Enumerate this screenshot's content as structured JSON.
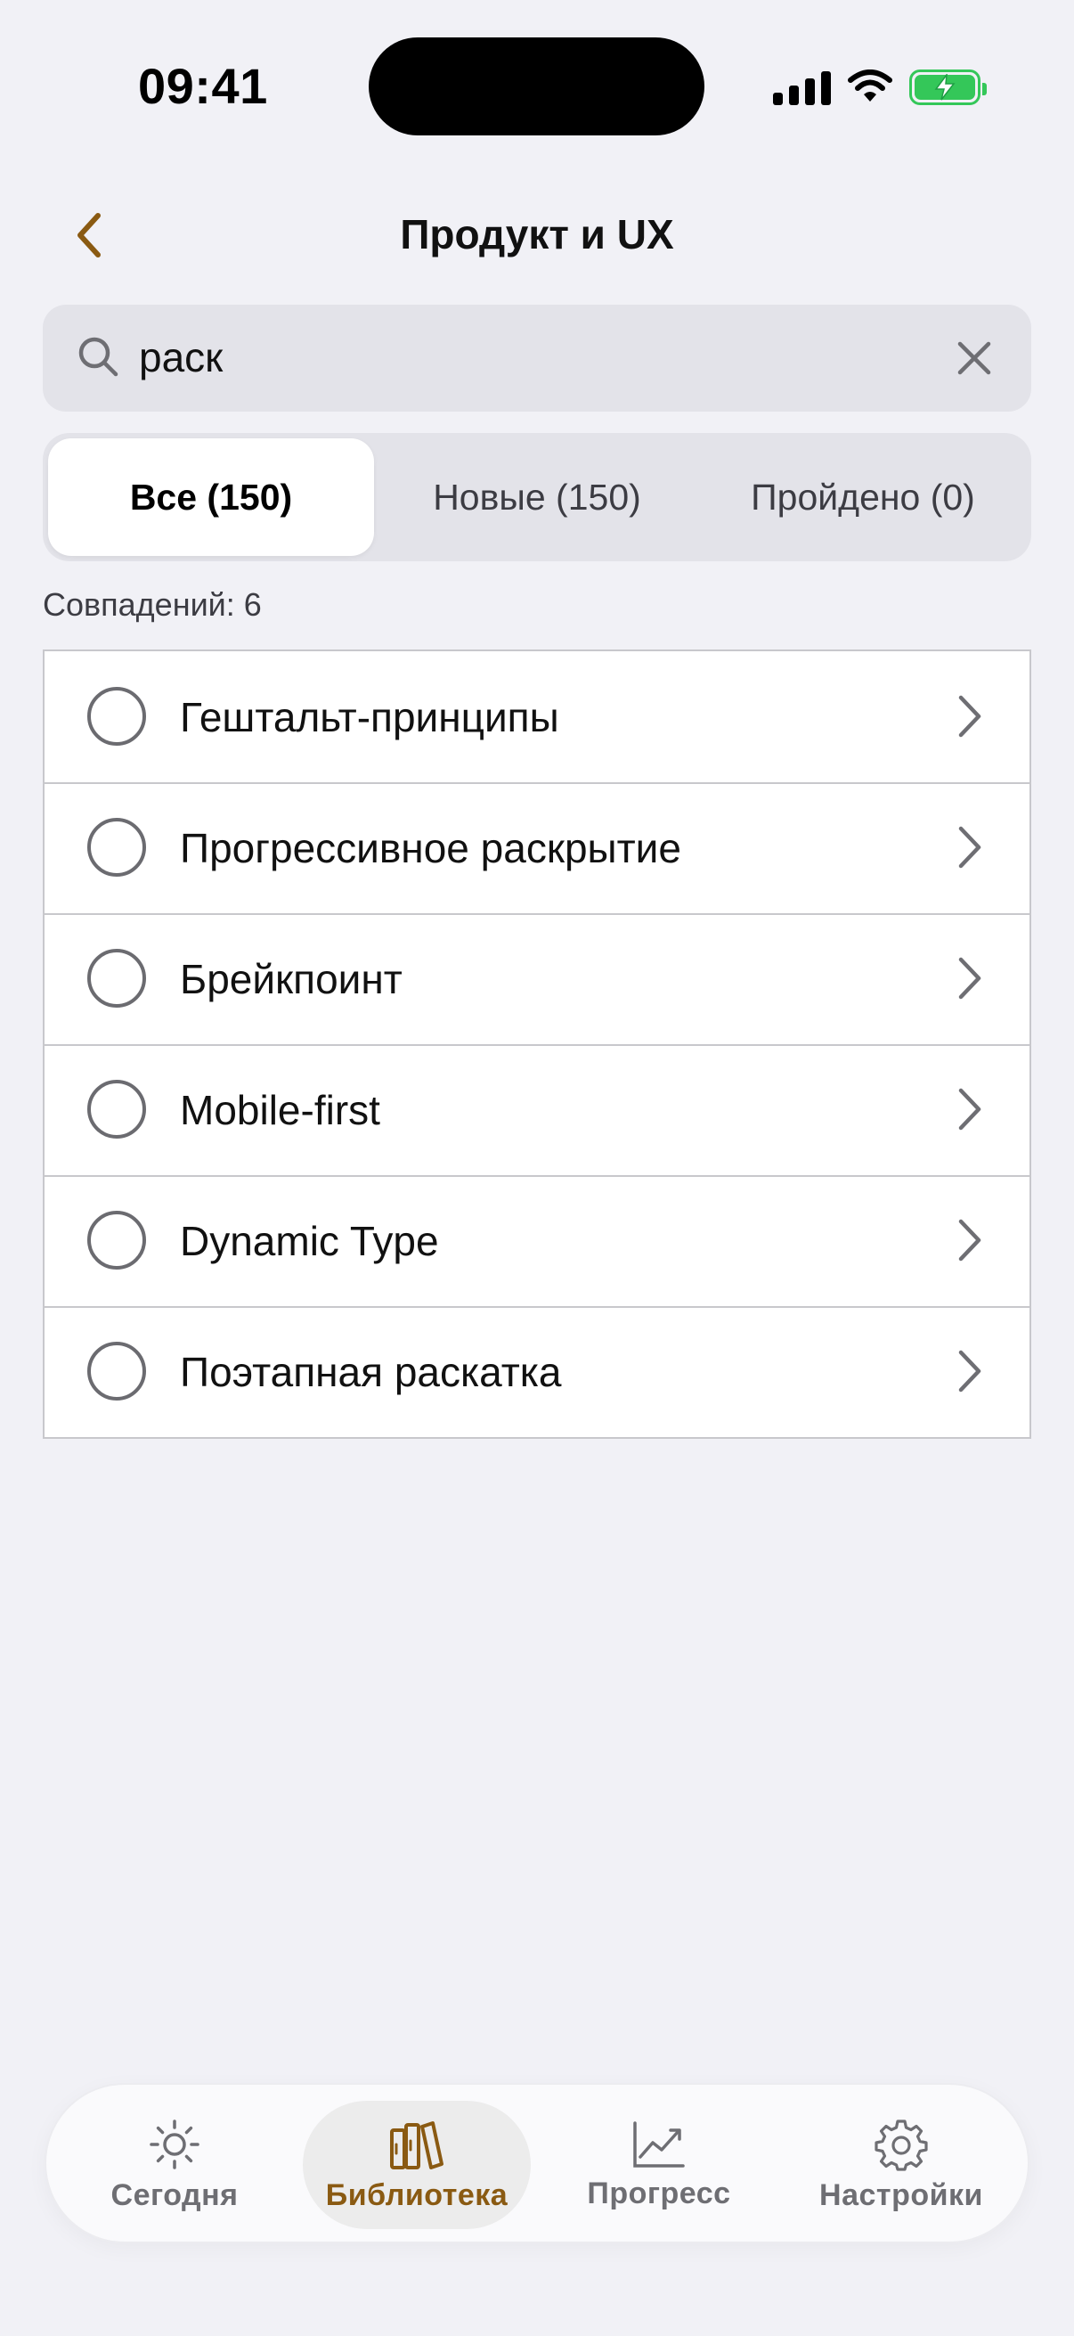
{
  "status_bar": {
    "time": "09:41"
  },
  "header": {
    "title": "Продукт и UX"
  },
  "search": {
    "value": "раск"
  },
  "segments": [
    {
      "label": "Все (150)",
      "active": true
    },
    {
      "label": "Новые (150)",
      "active": false
    },
    {
      "label": "Пройдено (0)",
      "active": false
    }
  ],
  "results": {
    "count_label": "Совпадений: 6"
  },
  "items": [
    {
      "label": "Гештальт-принципы"
    },
    {
      "label": "Прогрессивное раскрытие"
    },
    {
      "label": "Брейкпоинт"
    },
    {
      "label": "Mobile-first"
    },
    {
      "label": "Dynamic Type"
    },
    {
      "label": "Поэтапная раскатка"
    }
  ],
  "tabbar": {
    "tabs": [
      {
        "label": "Сегодня",
        "icon": "sun-icon",
        "active": false
      },
      {
        "label": "Библиотека",
        "icon": "books-icon",
        "active": true
      },
      {
        "label": "Прогресс",
        "icon": "chart-icon",
        "active": false
      },
      {
        "label": "Настройки",
        "icon": "gear-icon",
        "active": false
      }
    ]
  },
  "colors": {
    "accent": "#8A5A12",
    "background": "#F1F1F6",
    "battery": "#34C759"
  }
}
